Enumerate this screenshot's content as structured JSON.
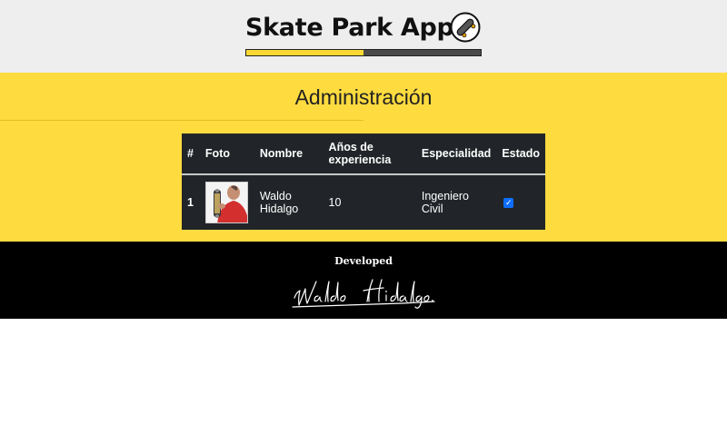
{
  "header": {
    "title": "Skate Park App",
    "logo_icon": "skateboard-icon",
    "progress_fraction": 0.5,
    "progress_fill_color": "#fdd835",
    "progress_track_color": "#4a4a4a"
  },
  "admin": {
    "title": "Administración",
    "background_color": "#fedb3f"
  },
  "table": {
    "headers": {
      "num": "#",
      "foto": "Foto",
      "nombre": "Nombre",
      "anos": "Años de experiencia",
      "especialidad": "Especialidad",
      "estado": "Estado"
    },
    "rows": [
      {
        "num": "1",
        "nombre": "Waldo Hidalgo",
        "anos": "10",
        "especialidad": "Ingeniero Civil",
        "estado_checked": true
      }
    ]
  },
  "footer": {
    "label": "Developed",
    "signature": "Waldo Hidalgo"
  }
}
